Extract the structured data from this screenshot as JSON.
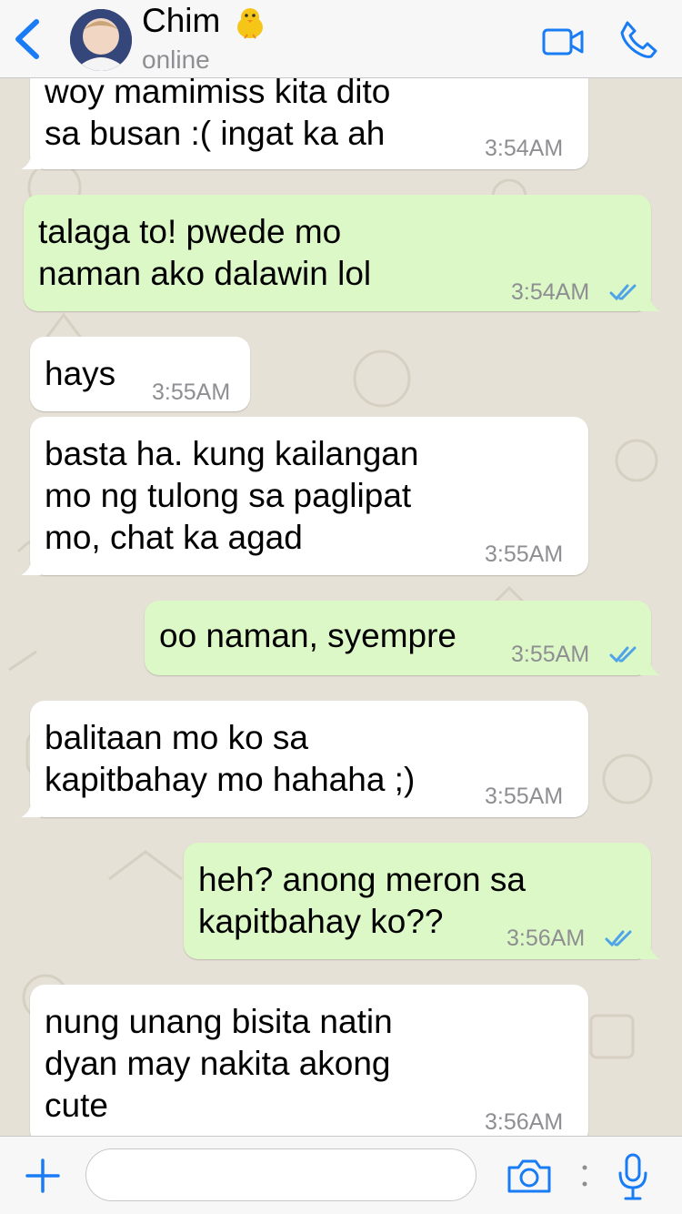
{
  "header": {
    "back_label": "Back",
    "contact_name": "Chim",
    "status": "online",
    "icons": [
      "back-chevron-icon",
      "chick-emoji-icon",
      "video-call-icon",
      "phone-icon"
    ]
  },
  "messages": [
    {
      "direction": "in",
      "text": "woy mamimiss kita dito\nsa busan :( ingat ka ah",
      "time": "3:54AM"
    },
    {
      "direction": "out",
      "text": "talaga to! pwede mo\nnaman ako dalawin lol",
      "time": "3:54AM",
      "read": true
    },
    {
      "direction": "in",
      "text": "hays",
      "time": "3:55AM"
    },
    {
      "direction": "in",
      "text": "basta ha. kung kailangan\nmo ng tulong sa paglipat\nmo, chat ka agad",
      "time": "3:55AM"
    },
    {
      "direction": "out",
      "text": "oo naman, syempre",
      "time": "3:55AM",
      "read": true
    },
    {
      "direction": "in",
      "text": "balitaan mo ko sa\nkapitbahay mo hahaha ;)",
      "time": "3:55AM"
    },
    {
      "direction": "out",
      "text": "heh? anong meron sa\nkapitbahay ko??",
      "time": "3:56AM",
      "read": true
    },
    {
      "direction": "in",
      "text": "nung unang bisita natin\ndyan may nakita akong\ncute",
      "time": "3:56AM"
    }
  ],
  "composer": {
    "input_value": "",
    "icons": [
      "plus-icon",
      "camera-icon",
      "more-dots-icon",
      "microphone-icon"
    ]
  },
  "colors": {
    "accent": "#1a7cf5",
    "incoming_bubble": "#ffffff",
    "outgoing_bubble": "#dcf8c6",
    "read_ticks": "#4fa3e8",
    "wallpaper": "#e6e1d6"
  }
}
